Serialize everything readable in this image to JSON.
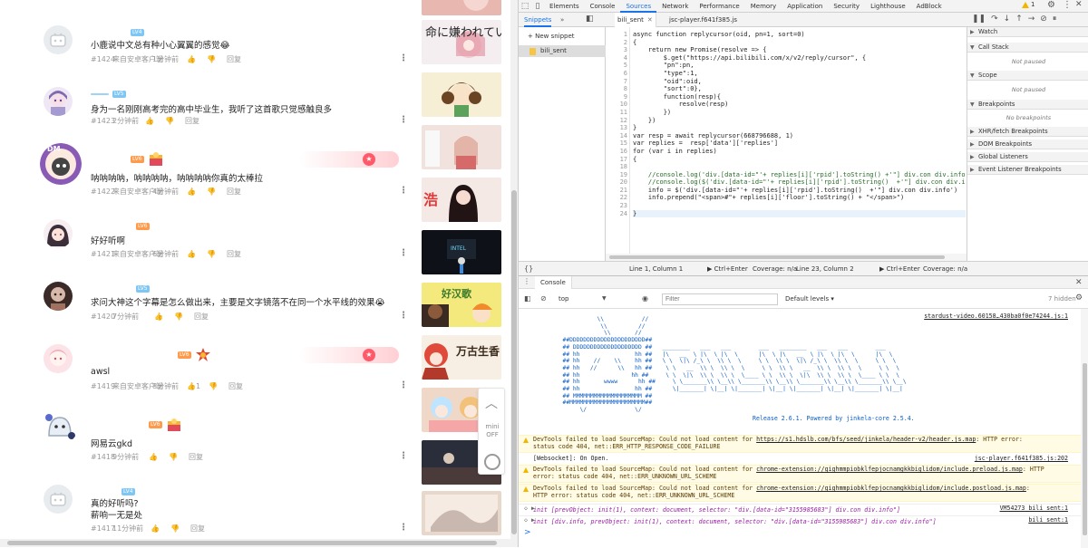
{
  "comments": [
    {
      "text": "小鹿说中文总有种小心翼翼的感觉😂",
      "floor": "#1424",
      "from": "来自安卓客户端",
      "time": "1分钟前",
      "reply": "回复",
      "likes": ""
    },
    {
      "text": "身为一名刚刚高考完的高中毕业生，我听了这首歌只觉感触良多",
      "floor": "#1423",
      "from": "",
      "time": "2分钟前",
      "reply": "回复",
      "likes": ""
    },
    {
      "text": "呐呐呐呐，呐呐呐呐，呐呐呐呐你真的太棒拉",
      "floor": "#1422",
      "from": "来自安卓客户端",
      "time": "4分钟前",
      "reply": "回复",
      "likes": ""
    },
    {
      "text": "好好听啊",
      "floor": "#1421",
      "from": "来自安卓客户端",
      "time": "6分钟前",
      "reply": "回复",
      "likes": ""
    },
    {
      "text": "求问大神这个字幕是怎么做出来，主要是文字镜落不在同一个水平线的效果😭",
      "floor": "#1420",
      "from": "",
      "time": "7分钟前",
      "reply": "回复",
      "likes": ""
    },
    {
      "text": "awsl",
      "floor": "#1419",
      "from": "来自安卓客户端",
      "time": "8分钟前",
      "reply": "回复",
      "likes": "1"
    },
    {
      "text": "网易云gkd",
      "floor": "#1418",
      "from": "",
      "time": "9分钟前",
      "reply": "回复",
      "likes": ""
    },
    {
      "text": "真的好听吗?",
      "text2": "薪响一无是处",
      "floor": "#1417",
      "from": "",
      "time": "11分钟前",
      "reply": "回复",
      "likes": ""
    }
  ],
  "thumbs": [
    {
      "caption": "命に嫌われている"
    },
    {
      "caption": ""
    },
    {
      "caption": ""
    },
    {
      "caption": ""
    },
    {
      "caption": ""
    },
    {
      "caption": ""
    },
    {
      "caption": "好汉歌"
    },
    {
      "caption": "万古生香"
    },
    {
      "caption": ""
    },
    {
      "caption": ""
    }
  ],
  "sidetools": {
    "mini": "mini",
    "off": "OFF"
  },
  "devtools": {
    "tabs": [
      "Elements",
      "Console",
      "Sources",
      "Network",
      "Performance",
      "Memory",
      "Application",
      "Security",
      "Lighthouse",
      "AdBlock"
    ],
    "active_tab": "Sources",
    "warnings": "1",
    "snippets_tab": "Snippets",
    "more": "»",
    "editor_tab1": "bili_sent",
    "editor_tab2": "jsc-player.f641f385.js",
    "new_snippet": "+ New snippet",
    "snippet_file": "bili_sent",
    "code_lines": [
      "async function replycursor(oid, pn=1, sort=0)",
      "{",
      "    return new Promise(resolve => {",
      "        $.get(\"https://api.bilibili.com/x/v2/reply/cursor\", {",
      "        \"pn\":pn,",
      "        \"type\":1,",
      "        \"oid\":oid,",
      "        \"sort\":0},",
      "        function(resp){",
      "            resolve(resp)",
      "        })",
      "    })",
      "}",
      "var resp = await replycursor(668796688, 1)",
      "var replies =  resp['data']['replies']",
      "for (var i in replies)",
      "{",
      "",
      "    //console.log('div.[data-id=\"'+ replies[i]['rpid'].toString() +'\"] div.con div.info",
      "    //console.log($('div.[data-id=\"'+ replies[i]['rpid'].toString()  +'\"] div.con div.i",
      "    info = $('div.[data-id=\"'+ replies[i]['rpid'].toString()  +'\"] div.con div.info')",
      "    info.prepend(\"<span>#\"+ replies[i]['floor'].toString() + \"</span>\")",
      "",
      "}"
    ],
    "debugger": {
      "watch": "Watch",
      "callstack": "Call Stack",
      "not_paused": "Not paused",
      "scope": "Scope",
      "breakpoints": "Breakpoints",
      "no_breakpoints": "No breakpoints",
      "xhr": "XHR/fetch Breakpoints",
      "dom": "DOM Breakpoints",
      "global": "Global Listeners",
      "event": "Event Listener Breakpoints"
    },
    "status": {
      "braces": "{}",
      "pos1": "Line 1, Column 1",
      "ctrl1": "▶ Ctrl+Enter",
      "cov1": "Coverage: n/a",
      "pos2": "Line 23, Column 2",
      "ctrl2": "▶ Ctrl+Enter",
      "cov2": "Coverage: n/a"
    },
    "console": {
      "title": "Console",
      "context": "top",
      "filter_placeholder": "Filter",
      "levels": "Default levels ▾",
      "hidden": "7 hidden",
      "first_src": "stardust-video.60158…430ba0f0e74244.js:1",
      "release": "Release 2.6.1. Powered by jinkela-core 2.5.4.",
      "messages": [
        {
          "type": "warn",
          "text": "DevTools failed to load SourceMap: Could not load content for ",
          "link": "https://s1.hdslb.com/bfs/seed/jinkela/header-v2/header.js.map",
          "tail": ": HTTP error:",
          "line2": "status code 404, net::ERR_HTTP_RESPONSE_CODE_FAILURE",
          "src": ""
        },
        {
          "type": "log",
          "text": "[Websocket]: On Open.",
          "src": "jsc-player.f641f385.js:202"
        },
        {
          "type": "warn",
          "text": "DevTools failed to load SourceMap: Could not load content for ",
          "link": "chrome-extension://gighmmpiobklfepjocnamgkkbiglidom/include.preload.js.map",
          "tail": ": HTTP",
          "line2": "error: status code 404, net::ERR_UNKNOWN_URL_SCHEME",
          "src": ""
        },
        {
          "type": "warn",
          "text": "DevTools failed to load SourceMap: Could not load content for ",
          "link": "chrome-extension://gighmmpiobklfepjocnamgkkbiglidom/include.postload.js.map",
          "tail": ":",
          "line2": "HTTP error: status code 404, net::ERR_UNKNOWN_URL_SCHEME",
          "src": ""
        }
      ],
      "obj1": "init [prevObject: init(1), context: document, selector: \"div.[data-id=\"3155985683\"] div.con div.info\"]",
      "obj1_src": "VM54273 bili_sent:1",
      "obj2": "init [div.info, prevObject: init(1), context: document, selector: \"div.[data-id=\"3155985683\"] div.con div.info\"]",
      "obj2_src": "bili_sent:1",
      "prompt": ">"
    }
  },
  "colors": {
    "accent": "#1a73e8",
    "warn_bg": "#fffbe5",
    "ascii": "#0a5cc4"
  }
}
